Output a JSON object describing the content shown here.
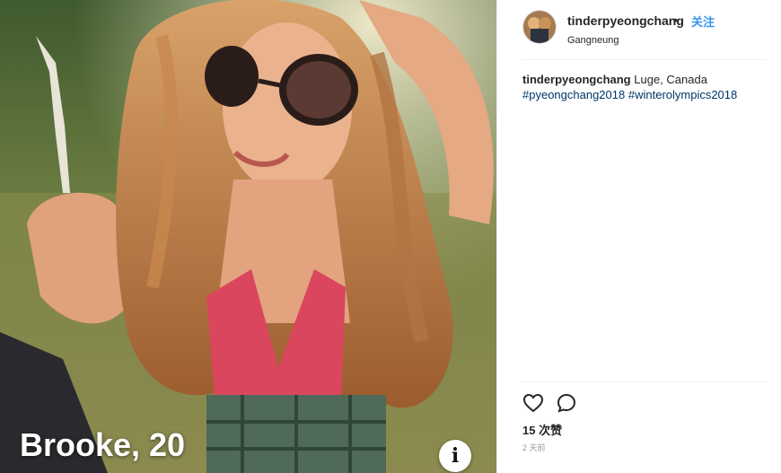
{
  "photo": {
    "overlay_name": "Brooke, 20",
    "info_icon": "info-icon",
    "info_glyph": "i"
  },
  "post": {
    "username": "tinderpyeongchang",
    "separator": "•",
    "follow_label": "关注",
    "location": "Gangneung",
    "caption_user": "tinderpyeongchang",
    "caption_text": "Luge, Canada",
    "hashtags": [
      "#pyeongchang2018",
      "#winterolympics2018"
    ],
    "likes": "15 次赞",
    "time": "2 天前"
  },
  "colors": {
    "accent": "#3897f0",
    "hashtag": "#003569"
  }
}
